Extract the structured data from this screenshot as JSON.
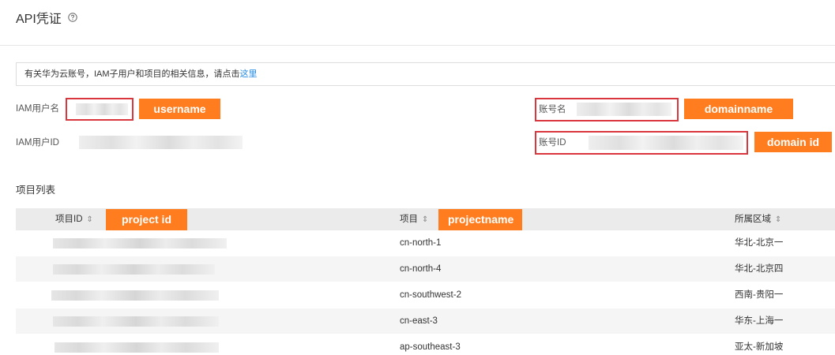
{
  "header": {
    "title": "API凭证"
  },
  "notice": {
    "text": "有关华为云账号，IAM子用户和项目的相关信息，请点击",
    "link": "这里"
  },
  "credentials": {
    "iam_username_label": "IAM用户名",
    "iam_userid_label": "IAM用户ID",
    "account_name_label": "账号名",
    "account_id_label": "账号ID"
  },
  "tags": {
    "username": "username",
    "domainname": "domainname",
    "domain_id": "domain id",
    "project_id": "project id",
    "projectname": "projectname"
  },
  "projects": {
    "section_title": "项目列表",
    "columns": [
      "项目ID",
      "项目",
      "所属区域"
    ],
    "rows": [
      {
        "project": "cn-north-1",
        "region": "华北-北京一"
      },
      {
        "project": "cn-north-4",
        "region": "华北-北京四"
      },
      {
        "project": "cn-southwest-2",
        "region": "西南-贵阳一"
      },
      {
        "project": "cn-east-3",
        "region": "华东-上海一"
      },
      {
        "project": "ap-southeast-3",
        "region": "亚太-新加坡"
      }
    ]
  },
  "colors": {
    "annotation_tag": "#ff7d1f",
    "highlight_border": "#d9363e",
    "link": "#1e88e5"
  }
}
